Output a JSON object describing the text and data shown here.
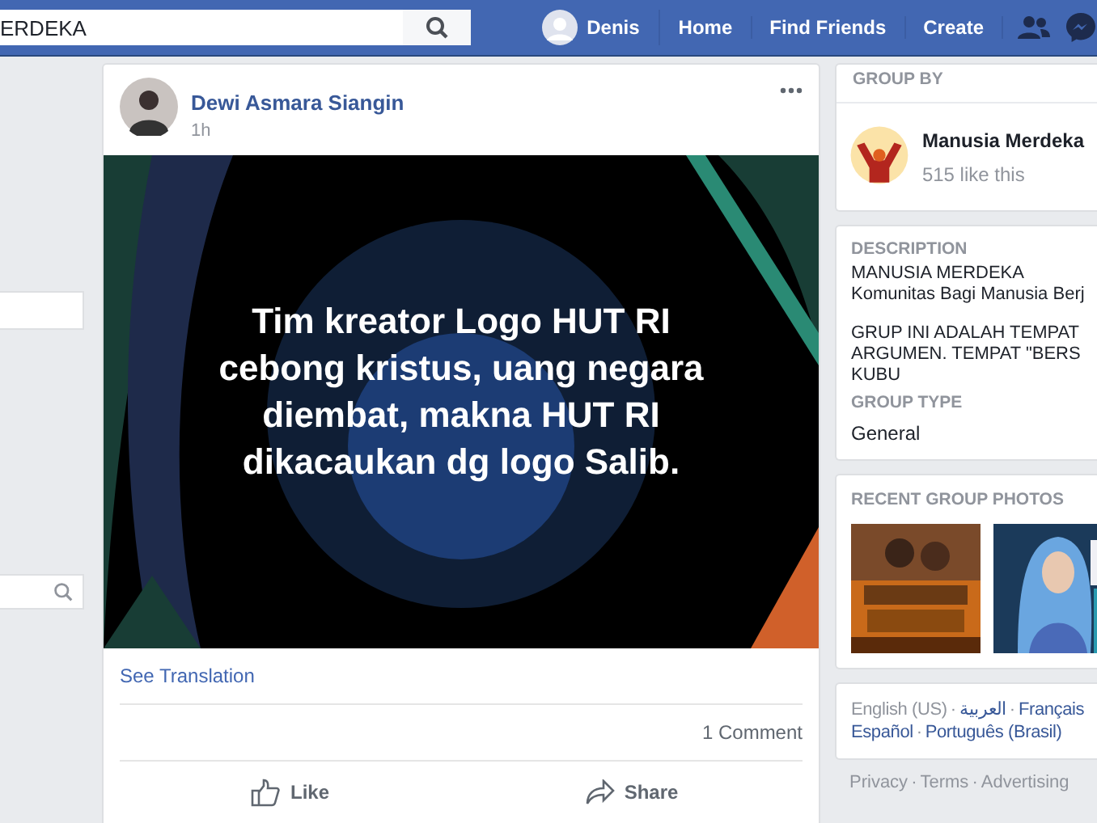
{
  "topbar": {
    "search": {
      "value": "ERDEKA"
    },
    "user": {
      "name": "Denis"
    },
    "nav": [
      "Home",
      "Find Friends",
      "Create"
    ]
  },
  "left": {
    "fields": [
      {
        "kind": "plain"
      },
      {
        "kind": "search"
      }
    ]
  },
  "post": {
    "author": "Dewi Asmara Siangin",
    "time": "1h",
    "image_caption": [
      "Tim kreator Logo HUT RI",
      "cebong kristus, uang negara",
      "diembat, makna HUT RI",
      "dikacaukan dg logo Salib."
    ],
    "see_translation": "See Translation",
    "comments": "1 Comment",
    "actions": [
      {
        "label": "Like",
        "kind": "like"
      },
      {
        "label": "Share",
        "kind": "share"
      }
    ]
  },
  "right": {
    "group_by": {
      "heading": "GROUP BY",
      "name": "Manusia Merdeka",
      "likes": "515 like this"
    },
    "about": {
      "description_heading": "DESCRIPTION",
      "description_paragraphs": [
        [
          "MANUSIA MERDEKA",
          "Komunitas Bagi Manusia Berj"
        ],
        [
          "GRUP INI ADALAH TEMPAT",
          "ARGUMEN. TEMPAT \"BERS",
          "KUBU"
        ]
      ],
      "type_heading": "GROUP TYPE",
      "type": "General"
    },
    "photos": {
      "heading": "RECENT GROUP PHOTOS"
    },
    "languages": [
      {
        "label": "English (US)",
        "selected": true
      },
      {
        "separator": "·",
        "label": "العربية",
        "selected": false
      },
      {
        "separator": "·",
        "label": "Français",
        "selected": false
      },
      {
        "label": "Español",
        "selected": false
      },
      {
        "separator": "·",
        "label": "Português (Brasil)",
        "selected": false
      }
    ],
    "footer_links": [
      {
        "label": "Privacy"
      },
      {
        "separator": "·",
        "label": "Terms"
      },
      {
        "separator": "·",
        "label": "Advertising"
      }
    ]
  }
}
